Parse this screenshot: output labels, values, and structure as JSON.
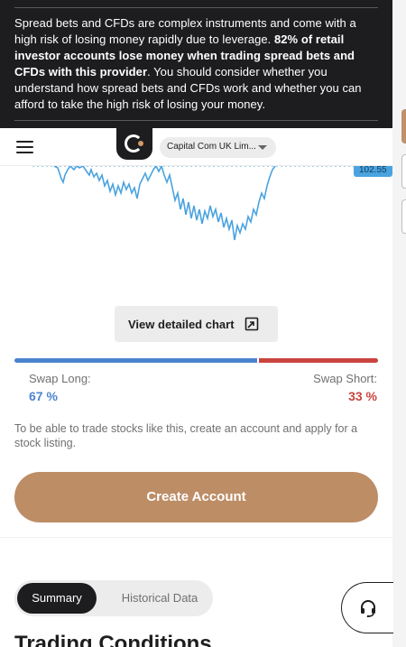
{
  "risk_warning": {
    "text_before": "Spread bets and CFDs are complex instruments and come with a high risk of losing money rapidly due to leverage. ",
    "text_bold": "82% of retail investor accounts lose money when trading spread bets and CFDs with this provider",
    "text_after": ". You should consider whether you understand how spread bets and CFDs work and whether you can afford to take the high risk of losing your money."
  },
  "header": {
    "menu_icon": "hamburger-menu-icon",
    "logo_icon": "capital-com-logo",
    "entity_selector": "Capital Com UK Lim..."
  },
  "chart": {
    "current_price": "102.55",
    "line_color": "#4aa3df",
    "view_detailed_label": "View detailed chart",
    "expand_icon": "expand-icon"
  },
  "swap": {
    "long_label": "Swap Long:",
    "long_value": "67 %",
    "long_fraction": 0.67,
    "short_label": "Swap Short:",
    "short_value": "33 %",
    "short_fraction": 0.33,
    "long_color": "#4c83d0",
    "short_color": "#c9443f"
  },
  "notice": "To be able to trade stocks like this, create an account and apply for a stock listing.",
  "cta": {
    "create_account": "Create Account",
    "color": "#bd8d66"
  },
  "tabs": [
    {
      "label": "Summary",
      "active": true
    },
    {
      "label": "Historical Data",
      "active": false
    }
  ],
  "section_title": "Trading Conditions",
  "support": {
    "icon": "headset-support-icon"
  }
}
